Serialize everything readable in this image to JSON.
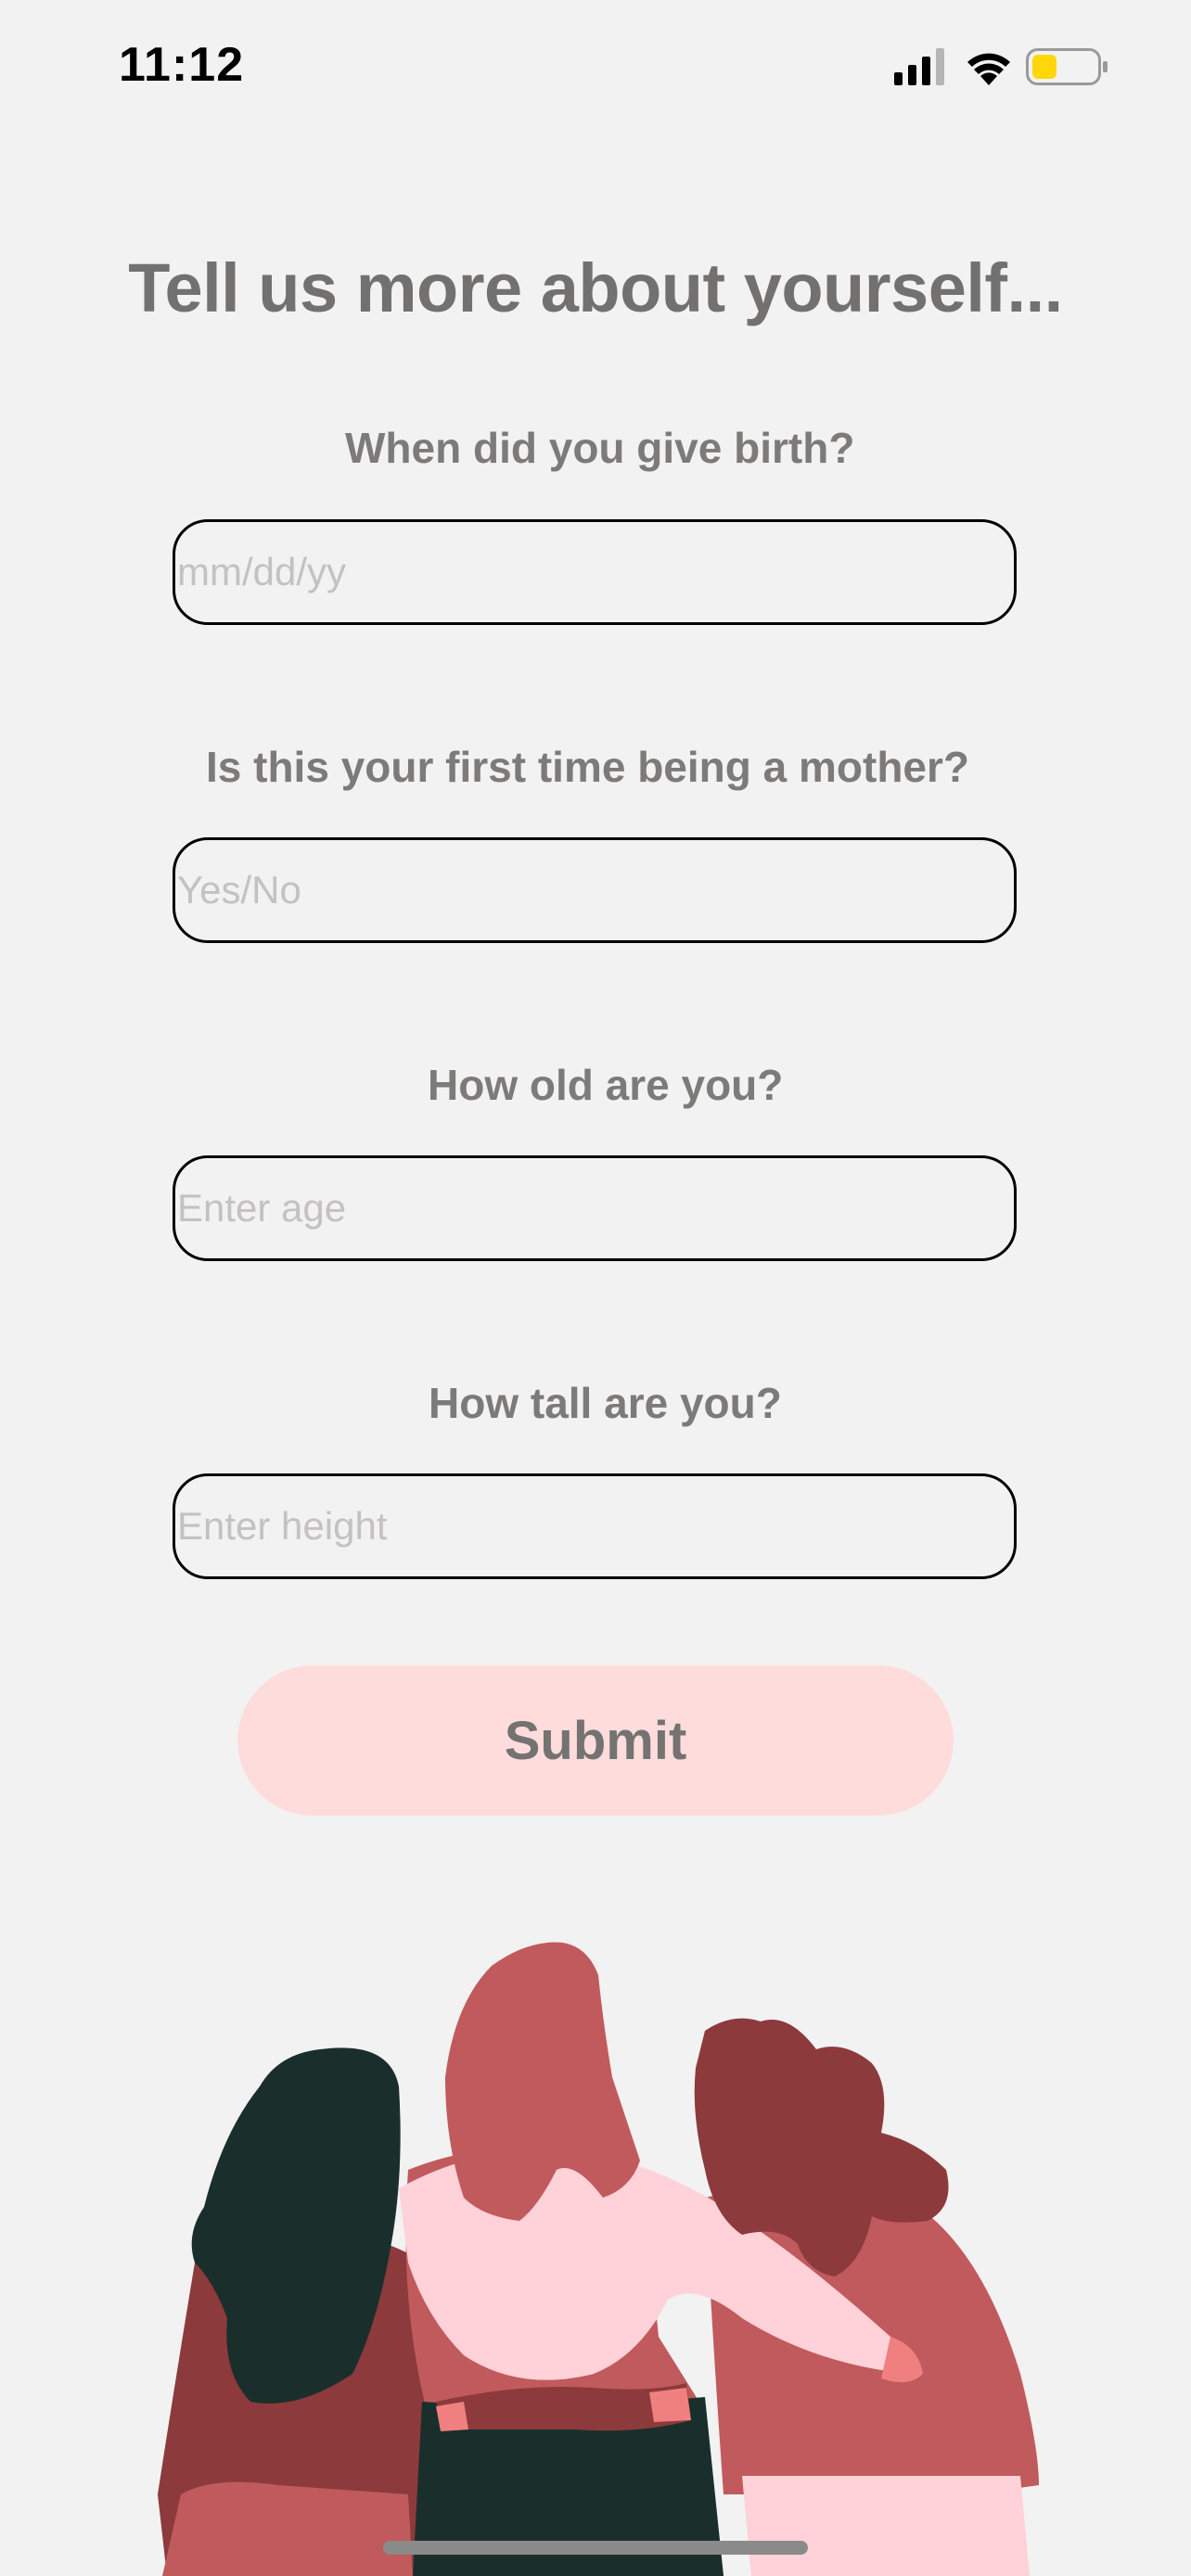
{
  "status_bar": {
    "time": "11:12",
    "icons": [
      "signal-icon",
      "wifi-icon",
      "battery-icon"
    ],
    "battery_color": "#ffd60a"
  },
  "title": "Tell us more about yourself...",
  "questions": [
    {
      "label": "When did you give birth?",
      "placeholder": "mm/dd/yy",
      "value": ""
    },
    {
      "label": "Is this your first time being a mother?",
      "placeholder": "Yes/No",
      "value": ""
    },
    {
      "label": "How old are you?",
      "placeholder": "Enter age",
      "value": ""
    },
    {
      "label": "How tall are you?",
      "placeholder": "Enter height",
      "value": ""
    }
  ],
  "submit_label": "Submit",
  "colors": {
    "background": "#f2f2f2",
    "submit_background": "#ffdcdc",
    "text": "#7d7a7a"
  }
}
